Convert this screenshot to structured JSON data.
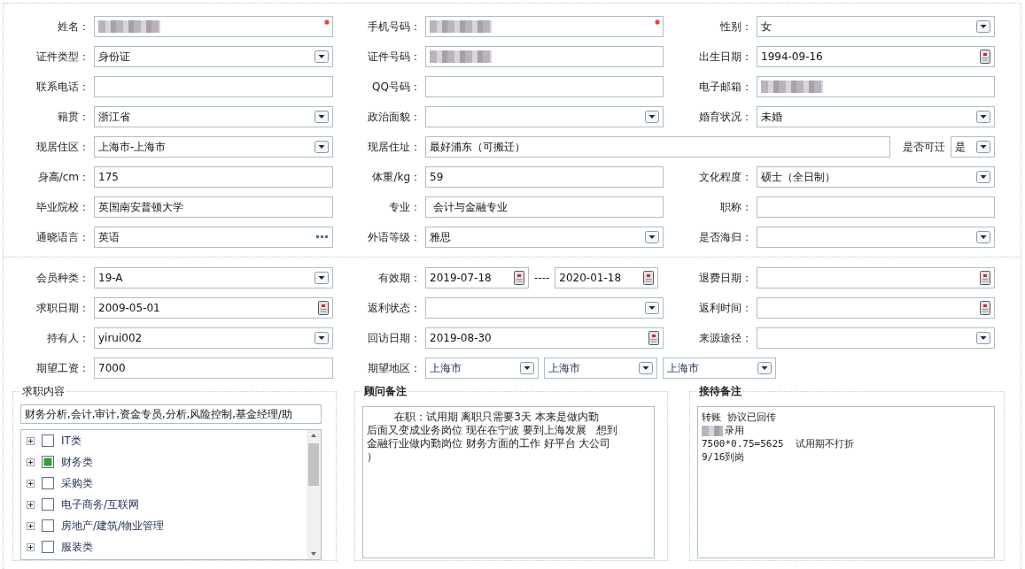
{
  "sections": [
    {
      "rows": [
        [
          {
            "label": "姓名：",
            "kind": "text",
            "redacted": true,
            "required": true
          },
          {
            "label": "手机号码：",
            "kind": "text",
            "redacted": true,
            "required": true
          },
          {
            "label": "性别：",
            "kind": "select",
            "value": "女"
          }
        ],
        [
          {
            "label": "证件类型：",
            "kind": "select",
            "value": "身份证"
          },
          {
            "label": "证件号码：",
            "kind": "text",
            "redacted": true
          },
          {
            "label": "出生日期：",
            "kind": "date",
            "value": "1994-09-16"
          }
        ],
        [
          {
            "label": "联系电话：",
            "kind": "text"
          },
          {
            "label": "QQ号码：",
            "kind": "text"
          },
          {
            "label": "电子邮箱：",
            "kind": "text",
            "redacted": true
          }
        ],
        [
          {
            "label": "籍贯：",
            "kind": "select",
            "value": "浙江省"
          },
          {
            "label": "政治面貌：",
            "kind": "select"
          },
          {
            "label": "婚育状况：",
            "kind": "select",
            "value": "未婚"
          }
        ],
        [
          {
            "label": "现居住区：",
            "kind": "select",
            "value": "上海市-上海市"
          },
          {
            "label": "现居住址：",
            "kind": "address",
            "value": "最好浦东（可搬迁）",
            "extra": {
              "label": "是否可迁",
              "value": "是"
            }
          }
        ],
        [
          {
            "label": "身高/cm：",
            "kind": "text",
            "value": "175"
          },
          {
            "label": "体重/kg：",
            "kind": "text",
            "value": "59"
          },
          {
            "label": "文化程度：",
            "kind": "select",
            "value": "硕士（全日制）"
          }
        ],
        [
          {
            "label": "毕业院校：",
            "kind": "text",
            "value": "英国南安普顿大学"
          },
          {
            "label": "专业：",
            "kind": "text",
            "value": " 会计与金融专业"
          },
          {
            "label": "职称：",
            "kind": "text"
          }
        ],
        [
          {
            "label": "通晓语言：",
            "kind": "picker",
            "value": "英语"
          },
          {
            "label": "外语等级：",
            "kind": "select",
            "value": "雅思"
          },
          {
            "label": "是否海归：",
            "kind": "select"
          }
        ]
      ]
    },
    {
      "rows": [
        [
          {
            "label": "会员种类：",
            "kind": "select",
            "value": "19-A"
          },
          {
            "label": "有效期：",
            "kind": "date_range",
            "values": [
              "2019-07-18",
              "2020-01-18"
            ],
            "separator": "----"
          },
          {
            "label": "退费日期：",
            "kind": "date"
          }
        ],
        [
          {
            "label": "求职日期：",
            "kind": "date",
            "value": "2009-05-01"
          },
          {
            "label": "返利状态：",
            "kind": "select"
          },
          {
            "label": "返利时间：",
            "kind": "date"
          }
        ],
        [
          {
            "label": "持有人：",
            "kind": "select",
            "value": "yirui002"
          },
          {
            "label": "回访日期：",
            "kind": "date",
            "value": "2019-08-30"
          },
          {
            "label": "来源途径：",
            "kind": "select"
          }
        ],
        [
          {
            "label": "期望工资：",
            "kind": "text",
            "value": "7000"
          },
          {
            "label": "期望地区：",
            "kind": "multi_select",
            "values": [
              "上海市",
              "上海市",
              "上海市"
            ]
          }
        ]
      ]
    }
  ],
  "panels": [
    {
      "kind": "tree",
      "legend": "求职内容",
      "bold": false,
      "value": "财务分析,会计,审计,资金专员,分析,风险控制,基金经理/助",
      "items": [
        {
          "label": "IT类",
          "checked": false
        },
        {
          "label": "财务类",
          "checked": true
        },
        {
          "label": "采购类",
          "checked": false
        },
        {
          "label": "电子商务/互联网",
          "checked": false
        },
        {
          "label": "房地产/建筑/物业管理",
          "checked": false
        },
        {
          "label": "服装类",
          "checked": false
        }
      ]
    },
    {
      "kind": "notes",
      "legend": "顾问备注",
      "bold": true,
      "mono": false,
      "lines": [
        {
          "text": "        在职：试用期 离职只需要3天 本来是做内勤"
        },
        {
          "text": "后面又变成业务岗位 现在在宁波 要到上海发展   想到"
        },
        {
          "text": "金融行业做内勤岗位 财务方面的工作 好平台 大公司"
        },
        {
          "text": "）"
        }
      ]
    },
    {
      "kind": "notes",
      "legend": "接待备注",
      "bold": true,
      "mono": true,
      "lines": [
        {
          "text": "转账 协议已回传"
        },
        {
          "text": "录用",
          "redacted": true
        },
        {
          "text": "7500*0.75=5625  试用期不打折"
        },
        {
          "text": "9/16到岗"
        }
      ]
    }
  ]
}
